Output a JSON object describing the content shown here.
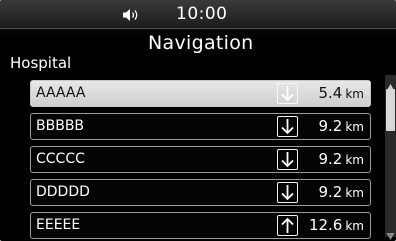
{
  "status": {
    "time": "10:00",
    "volume_icon": "speaker-icon"
  },
  "header": {
    "title": "Navigation",
    "category": "Hospital"
  },
  "list": {
    "items": [
      {
        "name": "AAAAA",
        "distance": "5.4",
        "unit": "km",
        "direction": "down",
        "selected": true
      },
      {
        "name": "BBBBB",
        "distance": "9.2",
        "unit": "km",
        "direction": "down",
        "selected": false
      },
      {
        "name": "CCCCC",
        "distance": "9.2",
        "unit": "km",
        "direction": "down",
        "selected": false
      },
      {
        "name": "DDDDD",
        "distance": "9.2",
        "unit": "km",
        "direction": "down",
        "selected": false
      },
      {
        "name": "EEEEE",
        "distance": "12.6",
        "unit": "km",
        "direction": "up",
        "selected": false
      }
    ]
  },
  "colors": {
    "background": "#000000",
    "selected_row": "#d8d8d8",
    "text": "#ffffff"
  }
}
